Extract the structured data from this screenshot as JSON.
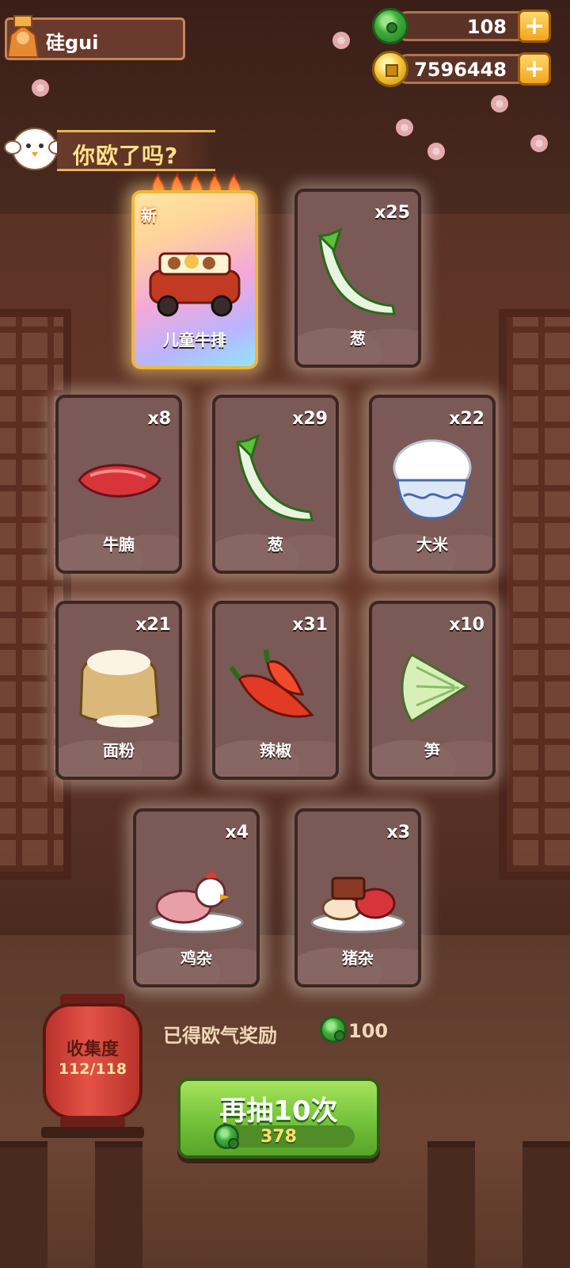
{
  "player": {
    "name": "硅gui"
  },
  "currencies": {
    "jade": {
      "value": "108",
      "icon": "jade-coin-icon"
    },
    "gold": {
      "value": "7596448",
      "icon": "gold-coin-icon"
    },
    "plus_label": "+"
  },
  "banner": {
    "title": "你欧了吗?"
  },
  "featured": {
    "label": "儿童牛排",
    "badge": "新",
    "stars": 5
  },
  "cards": [
    {
      "label": "葱",
      "count": "x25",
      "icon": "scallion-icon"
    },
    {
      "label": "牛腩",
      "count": "x8",
      "icon": "beef-brisket-icon"
    },
    {
      "label": "葱",
      "count": "x29",
      "icon": "scallion-icon"
    },
    {
      "label": "大米",
      "count": "x22",
      "icon": "rice-bowl-icon"
    },
    {
      "label": "面粉",
      "count": "x21",
      "icon": "flour-sack-icon"
    },
    {
      "label": "辣椒",
      "count": "x31",
      "icon": "chili-pepper-icon"
    },
    {
      "label": "笋",
      "count": "x10",
      "icon": "bamboo-shoot-icon"
    },
    {
      "label": "鸡杂",
      "count": "x4",
      "icon": "chicken-giblets-icon"
    },
    {
      "label": "猪杂",
      "count": "x3",
      "icon": "pork-offal-icon"
    }
  ],
  "collection": {
    "title": "收集度",
    "progress": "112/118"
  },
  "reward": {
    "text": "已得欧气奖励",
    "value": "100"
  },
  "draw": {
    "label": "再抽10次",
    "cost": "378"
  },
  "colors": {
    "card": "#7b5956",
    "accent_green": "#73c23a",
    "banner_text": "#ffe28a"
  }
}
